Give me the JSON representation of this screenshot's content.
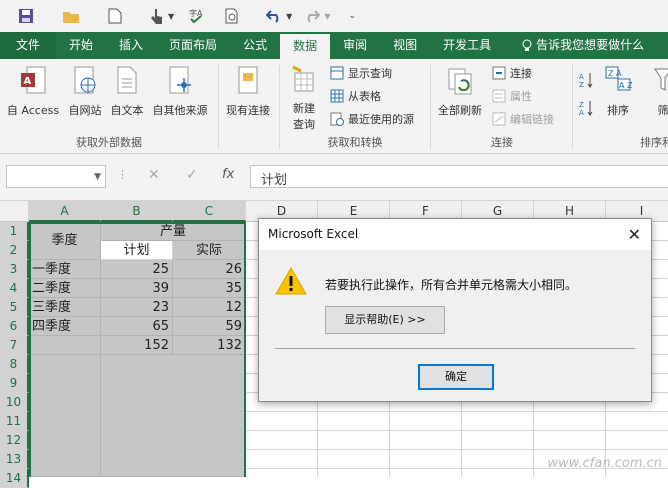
{
  "tabs": [
    "文件",
    "开始",
    "插入",
    "页面布局",
    "公式",
    "数据",
    "审阅",
    "视图",
    "开发工具"
  ],
  "tell_me": "告诉我您想要做什么",
  "ribbon": {
    "get_external": {
      "group_label": "获取外部数据",
      "buttons": [
        "自 Access",
        "自网站",
        "自文本",
        "自其他来源"
      ]
    },
    "existing_conn": "现有连接",
    "transform": {
      "group_label": "获取和转换",
      "new_query_1": "新建",
      "new_query_2": "查询",
      "show_query": "显示查询",
      "from_table": "从表格",
      "recent_sources": "最近使用的源"
    },
    "connections": {
      "group_label": "连接",
      "refresh_all": "全部刷新",
      "connections": "连接",
      "properties": "属性",
      "edit_links": "编辑链接"
    },
    "sort": {
      "group_label": "排序和",
      "sort": "排序",
      "filter": "筛"
    }
  },
  "formula_bar": {
    "fx": "fx",
    "content": "计划"
  },
  "columns": [
    "A",
    "B",
    "C",
    "D",
    "E",
    "F",
    "G",
    "H",
    "I"
  ],
  "rows": [
    "1",
    "2",
    "3",
    "4",
    "5",
    "6",
    "7",
    "8",
    "9",
    "10",
    "11",
    "12",
    "13",
    "14"
  ],
  "sheet": {
    "a1": "季度",
    "b1": "产量",
    "b2": "计划",
    "c2": "实际",
    "data": [
      {
        "q": "一季度",
        "plan": "25",
        "actual": "26"
      },
      {
        "q": "二季度",
        "plan": "39",
        "actual": "35"
      },
      {
        "q": "三季度",
        "plan": "23",
        "actual": "12"
      },
      {
        "q": "四季度",
        "plan": "65",
        "actual": "59"
      }
    ],
    "total_plan": "152",
    "total_actual": "132"
  },
  "dialog": {
    "title": "Microsoft Excel",
    "message": "若要执行此操作，所有合并单元格需大小相同。",
    "help_button": "显示帮助(E) >>",
    "ok_button": "确定"
  },
  "watermark": "www.cfan.com.cn",
  "colors": {
    "excel_green": "#217346",
    "selection_fill": "#c6c6c6",
    "warning_yellow": "#f8c400"
  }
}
